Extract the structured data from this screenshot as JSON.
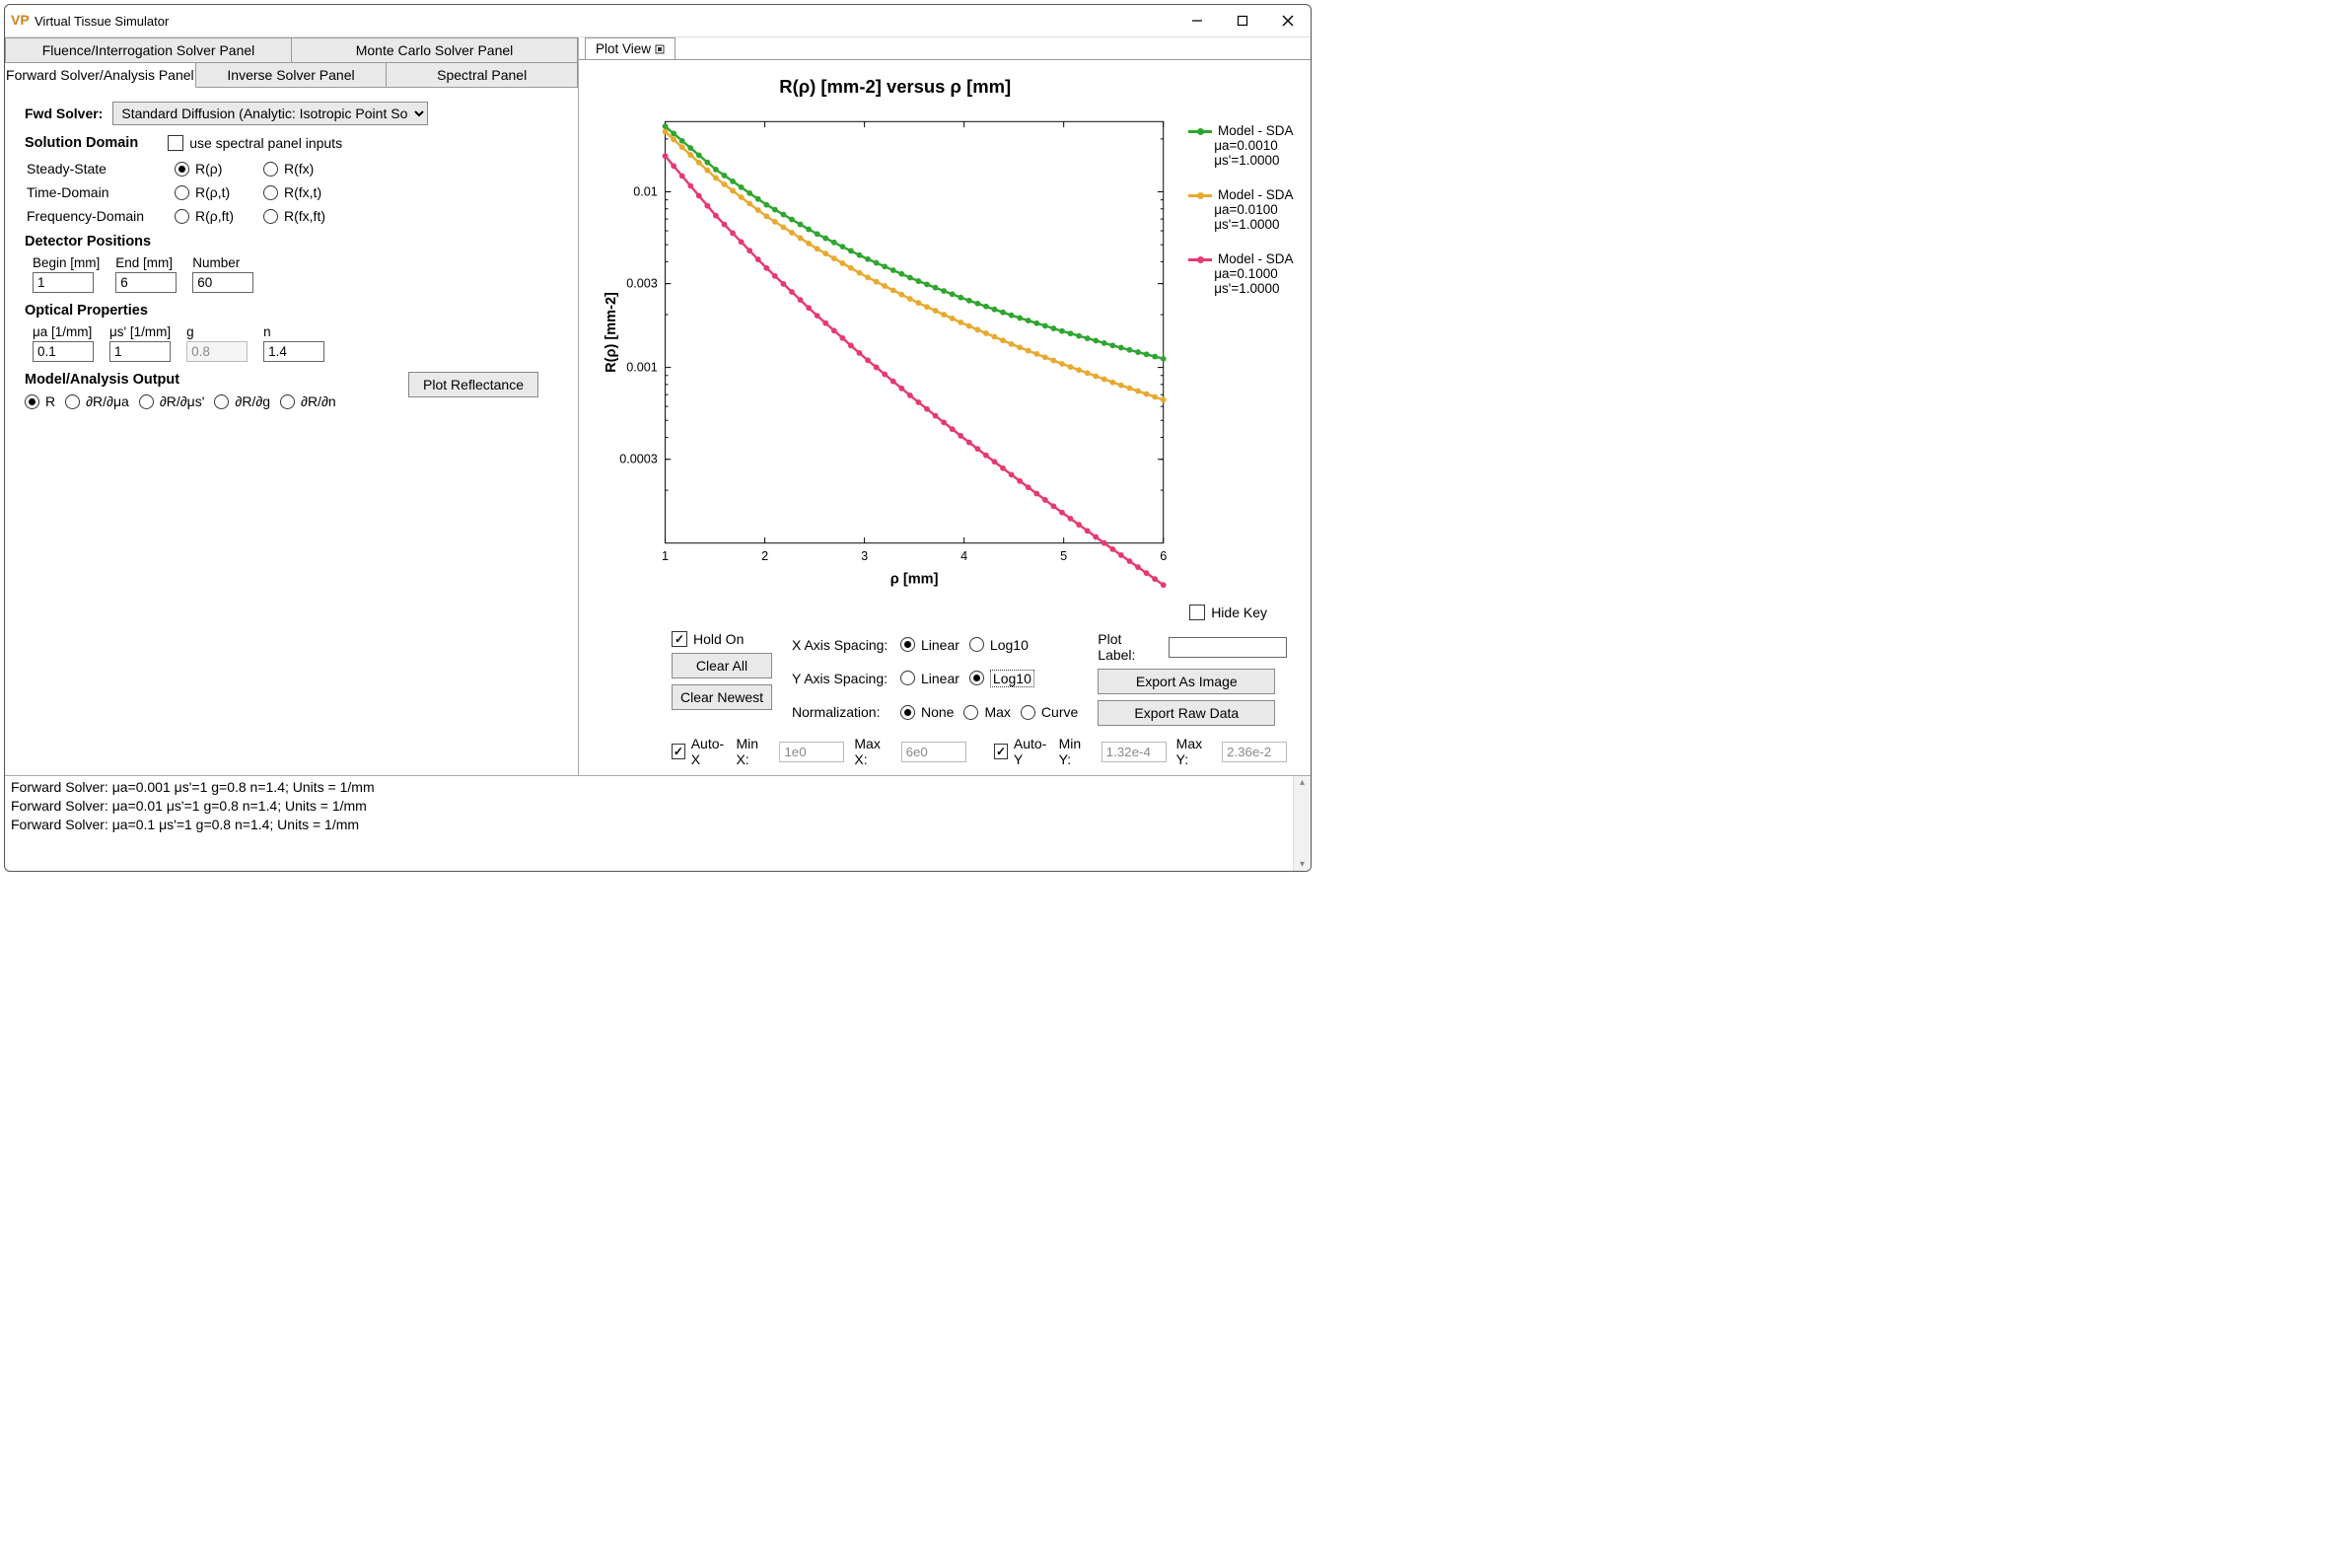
{
  "window": {
    "title": "Virtual Tissue Simulator",
    "icon_text": "VP"
  },
  "top_tabs": [
    {
      "label": "Fluence/Interrogation Solver Panel"
    },
    {
      "label": "Monte Carlo Solver Panel"
    }
  ],
  "sub_tabs": [
    {
      "label": "Forward Solver/Analysis Panel",
      "active": true
    },
    {
      "label": "Inverse Solver Panel",
      "active": false
    },
    {
      "label": "Spectral Panel",
      "active": false
    }
  ],
  "fwd_solver": {
    "label": "Fwd Solver:",
    "selected": "Standard Diffusion (Analytic: Isotropic Point Source)"
  },
  "solution_domain": {
    "title": "Solution Domain",
    "spectral_checkbox": {
      "label": "use spectral panel inputs",
      "checked": false
    },
    "rows": [
      {
        "label": "Steady-State",
        "opts": [
          {
            "label": "R(ρ)",
            "sel": true
          },
          {
            "label": "R(fx)",
            "sel": false
          }
        ]
      },
      {
        "label": "Time-Domain",
        "opts": [
          {
            "label": "R(ρ,t)",
            "sel": false
          },
          {
            "label": "R(fx,t)",
            "sel": false
          }
        ]
      },
      {
        "label": "Frequency-Domain",
        "opts": [
          {
            "label": "R(ρ,ft)",
            "sel": false
          },
          {
            "label": "R(fx,ft)",
            "sel": false
          }
        ]
      }
    ]
  },
  "detector": {
    "title": "Detector Positions",
    "cols": [
      {
        "label": "Begin [mm]",
        "value": "1"
      },
      {
        "label": "End [mm]",
        "value": "6"
      },
      {
        "label": "Number",
        "value": "60"
      }
    ]
  },
  "optical": {
    "title": "Optical Properties",
    "cols": [
      {
        "label": "μa [1/mm]",
        "value": "0.1",
        "enabled": true
      },
      {
        "label": "μs' [1/mm]",
        "value": "1",
        "enabled": true
      },
      {
        "label": "g",
        "value": "0.8",
        "enabled": false
      },
      {
        "label": "n",
        "value": "1.4",
        "enabled": true
      }
    ]
  },
  "model_output": {
    "title": "Model/Analysis Output",
    "opts": [
      {
        "label": "R",
        "sel": true
      },
      {
        "label": "∂R/∂μa",
        "sel": false
      },
      {
        "label": "∂R/∂μs'",
        "sel": false
      },
      {
        "label": "∂R/∂g",
        "sel": false
      },
      {
        "label": "∂R/∂n",
        "sel": false
      }
    ]
  },
  "plot_button": "Plot Reflectance",
  "plot_tab": {
    "label": "Plot View"
  },
  "chart": {
    "title": "R(ρ) [mm-2] versus ρ [mm]",
    "xlabel": "ρ [mm]",
    "ylabel": "R(ρ) [mm-2]",
    "x_ticks": [
      "1",
      "2",
      "3",
      "4",
      "5",
      "6"
    ],
    "y_ticks": [
      "0.0003",
      "0.001",
      "0.003",
      "0.01"
    ]
  },
  "legend": [
    {
      "name": "Model - SDA",
      "l2": "μa=0.0010",
      "l3": "μs'=1.0000",
      "color": "#2fa52f"
    },
    {
      "name": "Model - SDA",
      "l2": "μa=0.0100",
      "l3": "μs'=1.0000",
      "color": "#e8a92f"
    },
    {
      "name": "Model - SDA",
      "l2": "μa=0.1000",
      "l3": "μs'=1.0000",
      "color": "#e63a6f"
    }
  ],
  "hide_key": {
    "label": "Hide Key",
    "checked": false
  },
  "plot_controls": {
    "hold_on": {
      "label": "Hold On",
      "checked": true
    },
    "clear_all": "Clear All",
    "clear_newest": "Clear Newest",
    "x_axis": {
      "label": "X Axis Spacing:",
      "opts": [
        {
          "label": "Linear",
          "sel": true
        },
        {
          "label": "Log10",
          "sel": false
        }
      ]
    },
    "y_axis": {
      "label": "Y Axis Spacing:",
      "opts": [
        {
          "label": "Linear",
          "sel": false
        },
        {
          "label": "Log10",
          "sel": true
        }
      ]
    },
    "norm": {
      "label": "Normalization:",
      "opts": [
        {
          "label": "None",
          "sel": true
        },
        {
          "label": "Max",
          "sel": false
        },
        {
          "label": "Curve",
          "sel": false
        }
      ]
    },
    "plot_label": {
      "label": "Plot Label:",
      "value": ""
    },
    "export_image": "Export As Image",
    "export_data": "Export Raw Data",
    "auto_x": {
      "label": "Auto-X",
      "checked": true
    },
    "min_x": {
      "label": "Min X:",
      "value": "1e0"
    },
    "max_x": {
      "label": "Max X:",
      "value": "6e0"
    },
    "auto_y": {
      "label": "Auto-Y",
      "checked": true
    },
    "min_y": {
      "label": "Min Y:",
      "value": "1.32e-4"
    },
    "max_y": {
      "label": "Max Y:",
      "value": "2.36e-2"
    }
  },
  "log": [
    "Forward Solver: μa=0.001 μs'=1 g=0.8 n=1.4; Units = 1/mm",
    "Forward Solver: μa=0.01 μs'=1 g=0.8 n=1.4; Units = 1/mm",
    "Forward Solver: μa=0.1 μs'=1 g=0.8 n=1.4; Units = 1/mm"
  ],
  "chart_data": {
    "type": "line",
    "title": "R(ρ) [mm-2] versus ρ [mm]",
    "xlabel": "ρ [mm]",
    "ylabel": "R(ρ) [mm-2]",
    "x_range": [
      1,
      6
    ],
    "y_range_log10": [
      -4,
      -1.6
    ],
    "y_scale": "log10",
    "x_scale": "linear",
    "series": [
      {
        "name": "Model - SDA μa=0.0010 μs'=1.0000",
        "color": "#2fa52f",
        "x": [
          1.0,
          1.5,
          2.0,
          2.5,
          3.0,
          3.5,
          4.0,
          4.5,
          5.0,
          5.5,
          6.0
        ],
        "y": [
          0.0236,
          0.0135,
          0.00855,
          0.00585,
          0.00422,
          0.00317,
          0.00246,
          0.00196,
          0.0016,
          0.00133,
          0.00112
        ]
      },
      {
        "name": "Model - SDA μa=0.0100 μs'=1.0000",
        "color": "#e8a92f",
        "x": [
          1.0,
          1.5,
          2.0,
          2.5,
          3.0,
          3.5,
          4.0,
          4.5,
          5.0,
          5.5,
          6.0
        ],
        "y": [
          0.022,
          0.0121,
          0.00736,
          0.00483,
          0.00333,
          0.00239,
          0.00177,
          0.00134,
          0.00104,
          0.00082,
          0.000654
        ]
      },
      {
        "name": "Model - SDA μa=0.1000 μs'=1.0000",
        "color": "#e63a6f",
        "x": [
          1.0,
          1.5,
          2.0,
          2.5,
          3.0,
          3.5,
          4.0,
          4.5,
          5.0,
          5.5,
          6.0
        ],
        "y": [
          0.016,
          0.0074,
          0.00376,
          0.00203,
          0.00114,
          0.000662,
          0.000394,
          0.000239,
          0.000147,
          9.16e-05,
          5.77e-05
        ]
      }
    ]
  }
}
